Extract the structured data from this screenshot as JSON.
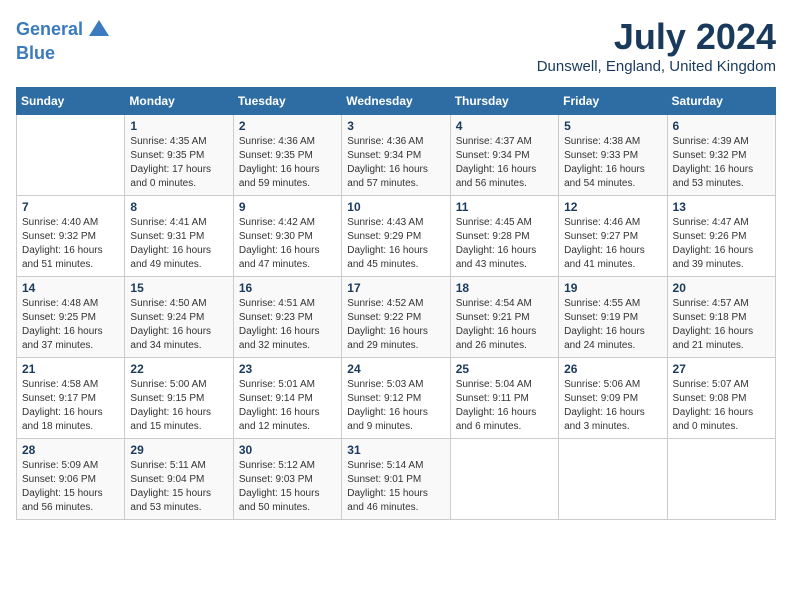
{
  "header": {
    "logo_line1": "General",
    "logo_line2": "Blue",
    "month_year": "July 2024",
    "location": "Dunswell, England, United Kingdom"
  },
  "weekdays": [
    "Sunday",
    "Monday",
    "Tuesday",
    "Wednesday",
    "Thursday",
    "Friday",
    "Saturday"
  ],
  "weeks": [
    [
      {
        "day": "",
        "info": ""
      },
      {
        "day": "1",
        "info": "Sunrise: 4:35 AM\nSunset: 9:35 PM\nDaylight: 17 hours\nand 0 minutes."
      },
      {
        "day": "2",
        "info": "Sunrise: 4:36 AM\nSunset: 9:35 PM\nDaylight: 16 hours\nand 59 minutes."
      },
      {
        "day": "3",
        "info": "Sunrise: 4:36 AM\nSunset: 9:34 PM\nDaylight: 16 hours\nand 57 minutes."
      },
      {
        "day": "4",
        "info": "Sunrise: 4:37 AM\nSunset: 9:34 PM\nDaylight: 16 hours\nand 56 minutes."
      },
      {
        "day": "5",
        "info": "Sunrise: 4:38 AM\nSunset: 9:33 PM\nDaylight: 16 hours\nand 54 minutes."
      },
      {
        "day": "6",
        "info": "Sunrise: 4:39 AM\nSunset: 9:32 PM\nDaylight: 16 hours\nand 53 minutes."
      }
    ],
    [
      {
        "day": "7",
        "info": "Sunrise: 4:40 AM\nSunset: 9:32 PM\nDaylight: 16 hours\nand 51 minutes."
      },
      {
        "day": "8",
        "info": "Sunrise: 4:41 AM\nSunset: 9:31 PM\nDaylight: 16 hours\nand 49 minutes."
      },
      {
        "day": "9",
        "info": "Sunrise: 4:42 AM\nSunset: 9:30 PM\nDaylight: 16 hours\nand 47 minutes."
      },
      {
        "day": "10",
        "info": "Sunrise: 4:43 AM\nSunset: 9:29 PM\nDaylight: 16 hours\nand 45 minutes."
      },
      {
        "day": "11",
        "info": "Sunrise: 4:45 AM\nSunset: 9:28 PM\nDaylight: 16 hours\nand 43 minutes."
      },
      {
        "day": "12",
        "info": "Sunrise: 4:46 AM\nSunset: 9:27 PM\nDaylight: 16 hours\nand 41 minutes."
      },
      {
        "day": "13",
        "info": "Sunrise: 4:47 AM\nSunset: 9:26 PM\nDaylight: 16 hours\nand 39 minutes."
      }
    ],
    [
      {
        "day": "14",
        "info": "Sunrise: 4:48 AM\nSunset: 9:25 PM\nDaylight: 16 hours\nand 37 minutes."
      },
      {
        "day": "15",
        "info": "Sunrise: 4:50 AM\nSunset: 9:24 PM\nDaylight: 16 hours\nand 34 minutes."
      },
      {
        "day": "16",
        "info": "Sunrise: 4:51 AM\nSunset: 9:23 PM\nDaylight: 16 hours\nand 32 minutes."
      },
      {
        "day": "17",
        "info": "Sunrise: 4:52 AM\nSunset: 9:22 PM\nDaylight: 16 hours\nand 29 minutes."
      },
      {
        "day": "18",
        "info": "Sunrise: 4:54 AM\nSunset: 9:21 PM\nDaylight: 16 hours\nand 26 minutes."
      },
      {
        "day": "19",
        "info": "Sunrise: 4:55 AM\nSunset: 9:19 PM\nDaylight: 16 hours\nand 24 minutes."
      },
      {
        "day": "20",
        "info": "Sunrise: 4:57 AM\nSunset: 9:18 PM\nDaylight: 16 hours\nand 21 minutes."
      }
    ],
    [
      {
        "day": "21",
        "info": "Sunrise: 4:58 AM\nSunset: 9:17 PM\nDaylight: 16 hours\nand 18 minutes."
      },
      {
        "day": "22",
        "info": "Sunrise: 5:00 AM\nSunset: 9:15 PM\nDaylight: 16 hours\nand 15 minutes."
      },
      {
        "day": "23",
        "info": "Sunrise: 5:01 AM\nSunset: 9:14 PM\nDaylight: 16 hours\nand 12 minutes."
      },
      {
        "day": "24",
        "info": "Sunrise: 5:03 AM\nSunset: 9:12 PM\nDaylight: 16 hours\nand 9 minutes."
      },
      {
        "day": "25",
        "info": "Sunrise: 5:04 AM\nSunset: 9:11 PM\nDaylight: 16 hours\nand 6 minutes."
      },
      {
        "day": "26",
        "info": "Sunrise: 5:06 AM\nSunset: 9:09 PM\nDaylight: 16 hours\nand 3 minutes."
      },
      {
        "day": "27",
        "info": "Sunrise: 5:07 AM\nSunset: 9:08 PM\nDaylight: 16 hours\nand 0 minutes."
      }
    ],
    [
      {
        "day": "28",
        "info": "Sunrise: 5:09 AM\nSunset: 9:06 PM\nDaylight: 15 hours\nand 56 minutes."
      },
      {
        "day": "29",
        "info": "Sunrise: 5:11 AM\nSunset: 9:04 PM\nDaylight: 15 hours\nand 53 minutes."
      },
      {
        "day": "30",
        "info": "Sunrise: 5:12 AM\nSunset: 9:03 PM\nDaylight: 15 hours\nand 50 minutes."
      },
      {
        "day": "31",
        "info": "Sunrise: 5:14 AM\nSunset: 9:01 PM\nDaylight: 15 hours\nand 46 minutes."
      },
      {
        "day": "",
        "info": ""
      },
      {
        "day": "",
        "info": ""
      },
      {
        "day": "",
        "info": ""
      }
    ]
  ]
}
